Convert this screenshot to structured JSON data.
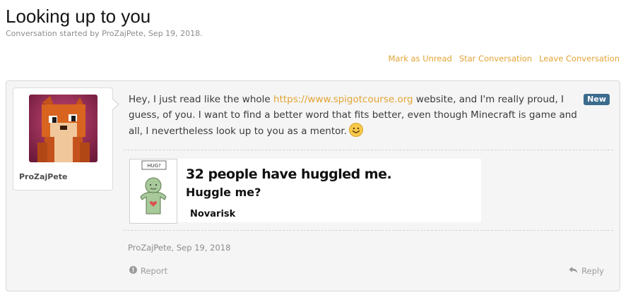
{
  "page": {
    "title": "Looking up to you",
    "subtitle": "Conversation started by ProZajPete, Sep 19, 2018."
  },
  "actions": {
    "mark_unread": "Mark as Unread",
    "star": "Star Conversation",
    "leave": "Leave Conversation"
  },
  "message": {
    "username": "ProZajPete",
    "badge": "New",
    "text_before_link": "Hey, I just read like the whole ",
    "link": "https://www.spigotcourse.org",
    "text_after_link": " website, and I'm really proud, I guess, of you. I want to find a better word that fits better, even though Minecraft is game and all, I nevertheless look up to you as a mentor.",
    "signature": {
      "tag": "HUG?",
      "line1": "32 people have huggled me.",
      "line2": "Huggle me?",
      "line3": "Novarisk"
    },
    "meta": "ProZajPete, Sep 19, 2018",
    "report_label": "Report",
    "reply_label": "Reply"
  },
  "colors": {
    "link": "#e2a434",
    "badge": "#3b6b8d",
    "message_bg": "#f5f5f5"
  },
  "icons": {
    "smiley": "smiley-icon",
    "report": "report-icon",
    "reply": "reply-icon"
  }
}
